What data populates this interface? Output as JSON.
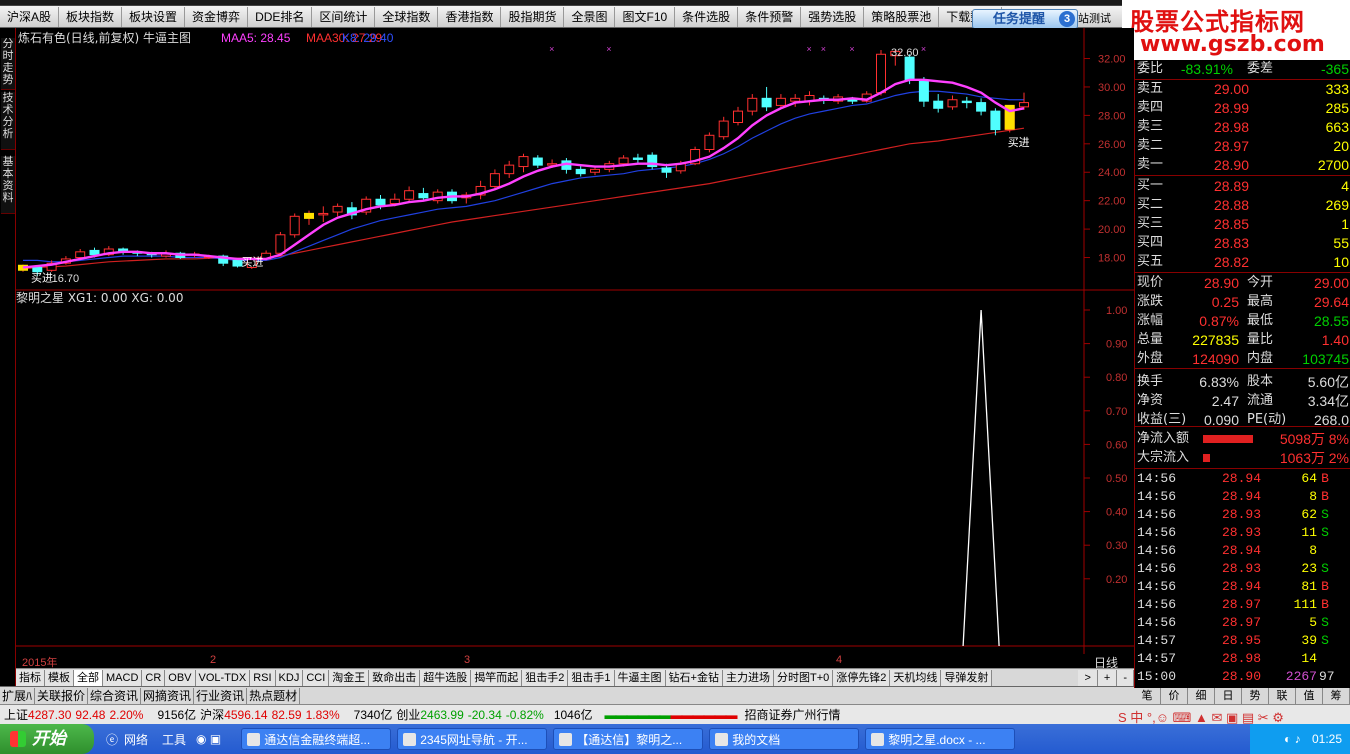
{
  "toolbar": [
    "沪深A股",
    "板块指数",
    "板块设置",
    "资金博弈",
    "DDE排名",
    "区间统计",
    "全球指数",
    "香港指数",
    "股指期货",
    "全景图",
    "图文F10",
    "条件选股",
    "条件预警",
    "强势选股",
    "策略股票池",
    "下载数据"
  ],
  "task_notice": {
    "label": "任务提醒",
    "count": "3"
  },
  "peek_label": "站测试",
  "brand": {
    "line1": "股票公式指标网",
    "line2": "www.gszb.com"
  },
  "left_tabs": [
    "分时走势",
    "技术分析",
    "基本资料"
  ],
  "main_header": {
    "title": "炼石有色(日线,前复权) 牛逼主图",
    "ma5_label": "MAA5: 28.45",
    "ma30_label": "MAA30: 27.29",
    "k_label": "K8: 29.40"
  },
  "sub_header": "黎明之星 XG1: 0.00  XG: 0.00",
  "annotations": {
    "buy1": "买进",
    "buy2": "买进",
    "buy3": "买进",
    "low": "16.70",
    "high": "32.60"
  },
  "x_labels": [
    "2015年",
    "2",
    "3",
    "4"
  ],
  "axis_unit": "日线",
  "chart_data": {
    "type": "candlestick",
    "price_ticks": [
      "32.00",
      "30.00",
      "28.00",
      "26.00",
      "24.00",
      "22.00",
      "20.00",
      "18.00"
    ],
    "price_range": [
      16.7,
      32.6
    ],
    "sub_ticks": [
      "1.00",
      "0.90",
      "0.80",
      "0.70",
      "0.60",
      "0.50",
      "0.40",
      "0.30",
      "0.20"
    ],
    "sub_range": [
      0,
      1
    ],
    "candles": [
      [
        17.2,
        17.35,
        17.0,
        17.5
      ],
      [
        17.3,
        17.0,
        16.7,
        17.4
      ],
      [
        17.1,
        17.6,
        17.0,
        17.8
      ],
      [
        17.6,
        17.9,
        17.5,
        18.1
      ],
      [
        18.0,
        18.4,
        17.9,
        18.6
      ],
      [
        18.5,
        18.2,
        18.0,
        18.7
      ],
      [
        18.2,
        18.6,
        18.1,
        18.8
      ],
      [
        18.6,
        18.4,
        18.2,
        18.7
      ],
      [
        18.4,
        18.3,
        18.1,
        18.5
      ],
      [
        18.3,
        18.2,
        18.0,
        18.4
      ],
      [
        18.1,
        18.3,
        18.0,
        18.5
      ],
      [
        18.3,
        18.0,
        17.9,
        18.4
      ],
      [
        18.2,
        18.25,
        18.0,
        18.4
      ],
      [
        18.0,
        18.1,
        17.9,
        18.2
      ],
      [
        18.1,
        17.6,
        17.4,
        18.2
      ],
      [
        17.8,
        17.4,
        17.3,
        17.9
      ],
      [
        17.3,
        17.9,
        17.2,
        18.0
      ],
      [
        17.9,
        18.3,
        17.8,
        18.5
      ],
      [
        18.3,
        19.6,
        18.2,
        19.8
      ],
      [
        19.6,
        20.9,
        19.4,
        21.1
      ],
      [
        20.8,
        21.0,
        20.3,
        21.3
      ],
      [
        21.0,
        21.1,
        20.5,
        21.6
      ],
      [
        21.2,
        21.6,
        20.9,
        21.8
      ],
      [
        21.5,
        21.0,
        20.7,
        21.9
      ],
      [
        21.2,
        22.1,
        21.0,
        22.3
      ],
      [
        22.1,
        21.7,
        21.4,
        22.4
      ],
      [
        21.8,
        22.1,
        21.6,
        22.5
      ],
      [
        22.1,
        22.7,
        21.9,
        23.0
      ],
      [
        22.5,
        22.2,
        22.0,
        22.9
      ],
      [
        22.0,
        22.6,
        21.8,
        22.8
      ],
      [
        22.6,
        22.0,
        21.8,
        22.8
      ],
      [
        22.2,
        22.4,
        21.8,
        22.6
      ],
      [
        22.4,
        23.0,
        22.1,
        23.4
      ],
      [
        23.0,
        23.9,
        22.8,
        24.2
      ],
      [
        23.9,
        24.5,
        23.6,
        24.8
      ],
      [
        24.4,
        25.1,
        24.0,
        25.3
      ],
      [
        25.0,
        24.5,
        24.3,
        25.2
      ],
      [
        24.5,
        24.6,
        24.3,
        24.9
      ],
      [
        24.8,
        24.2,
        23.9,
        25.0
      ],
      [
        24.2,
        23.9,
        23.7,
        24.5
      ],
      [
        24.0,
        24.2,
        23.8,
        24.4
      ],
      [
        24.2,
        24.6,
        24.0,
        24.8
      ],
      [
        24.6,
        25.0,
        24.4,
        25.2
      ],
      [
        25.0,
        24.9,
        24.6,
        25.3
      ],
      [
        25.2,
        24.4,
        24.2,
        25.4
      ],
      [
        24.3,
        24.0,
        23.6,
        24.6
      ],
      [
        24.1,
        24.6,
        23.9,
        24.8
      ],
      [
        24.6,
        25.6,
        24.5,
        25.8
      ],
      [
        25.6,
        26.6,
        25.4,
        26.8
      ],
      [
        26.5,
        27.6,
        26.3,
        27.9
      ],
      [
        27.5,
        28.3,
        27.3,
        28.6
      ],
      [
        28.3,
        29.2,
        28.0,
        29.5
      ],
      [
        29.2,
        28.6,
        28.3,
        30.0
      ],
      [
        28.7,
        29.2,
        28.5,
        29.5
      ],
      [
        29.0,
        29.2,
        28.6,
        29.5
      ],
      [
        29.0,
        29.4,
        28.7,
        29.7
      ],
      [
        29.2,
        29.1,
        28.8,
        29.4
      ],
      [
        29.0,
        29.3,
        28.8,
        29.5
      ],
      [
        29.2,
        29.0,
        28.8,
        29.3
      ],
      [
        29.0,
        29.5,
        28.9,
        29.7
      ],
      [
        29.6,
        32.3,
        29.4,
        32.6
      ],
      [
        32.2,
        32.5,
        31.5,
        32.6
      ],
      [
        32.1,
        30.5,
        30.2,
        32.3
      ],
      [
        30.4,
        29.0,
        28.6,
        30.7
      ],
      [
        29.0,
        28.5,
        28.2,
        29.5
      ],
      [
        28.6,
        29.1,
        28.4,
        29.4
      ],
      [
        29.0,
        28.9,
        28.5,
        29.3
      ],
      [
        28.9,
        28.3,
        28.0,
        29.2
      ],
      [
        28.3,
        27.0,
        26.6,
        28.5
      ],
      [
        27.0,
        28.6,
        26.8,
        28.7
      ],
      [
        28.6,
        28.9,
        28.4,
        29.6
      ]
    ],
    "ma5": [
      17.3,
      17.4,
      17.5,
      17.7,
      17.9,
      18.1,
      18.3,
      18.4,
      18.4,
      18.3,
      18.3,
      18.2,
      18.2,
      18.1,
      18.0,
      17.9,
      17.9,
      17.9,
      18.2,
      18.9,
      19.6,
      20.3,
      20.8,
      21.1,
      21.4,
      21.6,
      21.7,
      21.9,
      22.0,
      22.2,
      22.3,
      22.3,
      22.5,
      22.8,
      23.2,
      23.7,
      24.1,
      24.4,
      24.6,
      24.5,
      24.4,
      24.4,
      24.5,
      24.6,
      24.6,
      24.5,
      24.6,
      24.8,
      25.1,
      25.7,
      26.4,
      27.3,
      28.0,
      28.5,
      28.9,
      29.0,
      29.1,
      29.1,
      29.2,
      29.1,
      29.6,
      30.2,
      30.5,
      30.5,
      30.4,
      30.3,
      30.0,
      29.6,
      28.9,
      28.3,
      28.5
    ],
    "ma30": [
      17.2,
      17.3,
      17.35,
      17.4,
      17.5,
      17.6,
      17.7,
      17.75,
      17.8,
      17.85,
      17.9,
      17.9,
      17.9,
      17.95,
      17.95,
      17.95,
      17.95,
      18.0,
      18.1,
      18.3,
      18.5,
      18.7,
      18.9,
      19.1,
      19.3,
      19.5,
      19.7,
      19.9,
      20.1,
      20.3,
      20.5,
      20.65,
      20.8,
      20.95,
      21.1,
      21.25,
      21.4,
      21.55,
      21.7,
      21.85,
      22.0,
      22.15,
      22.3,
      22.45,
      22.6,
      22.75,
      22.9,
      23.05,
      23.2,
      23.4,
      23.6,
      23.8,
      24.0,
      24.2,
      24.4,
      24.6,
      24.8,
      25.0,
      25.2,
      25.4,
      25.6,
      25.8,
      26.0,
      26.1,
      26.2,
      26.35,
      26.5,
      26.65,
      26.8,
      26.95,
      27.1
    ],
    "mak": [
      17.8,
      17.8,
      17.7,
      17.7,
      17.8,
      17.9,
      18.0,
      18.1,
      18.1,
      18.1,
      18.1,
      18.0,
      18.0,
      18.0,
      17.9,
      17.8,
      17.8,
      17.8,
      18.0,
      18.4,
      18.8,
      19.2,
      19.6,
      20.0,
      20.3,
      20.6,
      20.8,
      21.0,
      21.2,
      21.4,
      21.5,
      21.6,
      21.8,
      22.0,
      22.3,
      22.6,
      22.9,
      23.2,
      23.4,
      23.6,
      23.7,
      23.8,
      23.9,
      24.1,
      24.2,
      24.3,
      24.4,
      24.6,
      24.9,
      25.3,
      25.8,
      26.4,
      26.9,
      27.4,
      27.8,
      28.1,
      28.3,
      28.5,
      28.7,
      28.8,
      29.1,
      29.4,
      29.6,
      29.7,
      29.7,
      29.6,
      29.5,
      29.3,
      29.2,
      29.1,
      29.1
    ],
    "signal_index": 67,
    "signal_value": 1.0
  },
  "bottom_tabs": [
    "指标",
    "模板",
    "全部",
    "MACD",
    "CR",
    "OBV",
    "VOL-TDX",
    "RSI",
    "KDJ",
    "CCI",
    "淘金王",
    "致命出击",
    "超牛选股",
    "揭竿而起",
    "狙击手2",
    "狙击手1",
    "牛逼主图",
    "钻石+金钻",
    "主力进场",
    "分时图T+0",
    "涨停先锋2",
    "天机均线",
    "导弹发射"
  ],
  "bottom_controls": [
    ">",
    "+",
    "-"
  ],
  "info_tabs": [
    "扩展ﾊ",
    "关联报价",
    "综合资讯",
    "网摘资讯",
    "行业资讯",
    "热点题材"
  ],
  "quote": {
    "weibi": {
      "label1": "委比",
      "v1": "-83.91%",
      "label2": "委差",
      "v2": "-365"
    },
    "asks": [
      {
        "label": "卖五",
        "price": "29.00",
        "vol": "333"
      },
      {
        "label": "卖四",
        "price": "28.99",
        "vol": "285"
      },
      {
        "label": "卖三",
        "price": "28.98",
        "vol": "663"
      },
      {
        "label": "卖二",
        "price": "28.97",
        "vol": "20"
      },
      {
        "label": "卖一",
        "price": "28.90",
        "vol": "2700"
      }
    ],
    "bids": [
      {
        "label": "买一",
        "price": "28.89",
        "vol": "4"
      },
      {
        "label": "买二",
        "price": "28.88",
        "vol": "269"
      },
      {
        "label": "买三",
        "price": "28.85",
        "vol": "1"
      },
      {
        "label": "买四",
        "price": "28.83",
        "vol": "55"
      },
      {
        "label": "买五",
        "price": "28.82",
        "vol": "10"
      }
    ],
    "stats": [
      {
        "l1": "现价",
        "v1": "28.90",
        "l2": "今开",
        "v2": "29.00"
      },
      {
        "l1": "涨跌",
        "v1": "0.25",
        "l2": "最高",
        "v2": "29.64"
      },
      {
        "l1": "涨幅",
        "v1": "0.87%",
        "l2": "最低",
        "v2": "28.55"
      },
      {
        "l1": "总量",
        "v1": "227835",
        "l2": "量比",
        "v2": "1.40"
      },
      {
        "l1": "外盘",
        "v1": "124090",
        "l2": "内盘",
        "v2": "103745"
      },
      {
        "l1": "换手",
        "v1": "6.83%",
        "l2": "股本",
        "v2": "5.60亿"
      },
      {
        "l1": "净资",
        "v1": "2.47",
        "l2": "流通",
        "v2": "3.34亿"
      },
      {
        "l1": "收益(三)",
        "v1": "0.090",
        "l2": "PE(动)",
        "v2": "268.0"
      }
    ],
    "flows": [
      {
        "label": "净流入额",
        "value": "5098万",
        "pct": "8%",
        "bar": 0.8
      },
      {
        "label": "大宗流入",
        "value": "1063万",
        "pct": "2%",
        "bar": 0.12
      }
    ],
    "ticks": [
      {
        "t": "14:56",
        "p": "28.94",
        "v": "64",
        "bs": "B"
      },
      {
        "t": "14:56",
        "p": "28.94",
        "v": "8",
        "bs": "B"
      },
      {
        "t": "14:56",
        "p": "28.93",
        "v": "62",
        "bs": "S"
      },
      {
        "t": "14:56",
        "p": "28.93",
        "v": "11",
        "bs": "S"
      },
      {
        "t": "14:56",
        "p": "28.94",
        "v": "8",
        "bs": ""
      },
      {
        "t": "14:56",
        "p": "28.93",
        "v": "23",
        "bs": "S"
      },
      {
        "t": "14:56",
        "p": "28.94",
        "v": "81",
        "bs": "B"
      },
      {
        "t": "14:56",
        "p": "28.97",
        "v": "111",
        "bs": "B"
      },
      {
        "t": "14:56",
        "p": "28.97",
        "v": "5",
        "bs": "S"
      },
      {
        "t": "14:57",
        "p": "28.95",
        "v": "39",
        "bs": "S"
      },
      {
        "t": "14:57",
        "p": "28.98",
        "v": "14",
        "bs": ""
      },
      {
        "t": "15:00",
        "p": "28.90",
        "v": "2267",
        "bs": "97"
      }
    ]
  },
  "right_tabs": [
    "笔",
    "价",
    "细",
    "日",
    "势",
    "联",
    "值",
    "筹"
  ],
  "index_bar": {
    "sh": {
      "label": "上证",
      "val": "4287.30",
      "chg": "92.48",
      "pct": "2.20%",
      "amt": "9156亿"
    },
    "hs": {
      "label": "沪深",
      "val": "4596.14",
      "chg": "82.59",
      "pct": "1.83%",
      "amt": "7340亿"
    },
    "cy": {
      "label": "创业",
      "val": "2463.99",
      "chg": "-20.34",
      "pct": "-0.82%",
      "amt": "1046亿"
    },
    "broker": "招商证券广州行情"
  },
  "taskbar": {
    "start": "开始",
    "network": "网络",
    "tools": "工具",
    "tasks": [
      "通达信金融终端超...",
      "2345网址导航 - 开...",
      "【通达信】黎明之...",
      "我的文档",
      "黎明之星.docx - ..."
    ],
    "clock": "01:25"
  }
}
